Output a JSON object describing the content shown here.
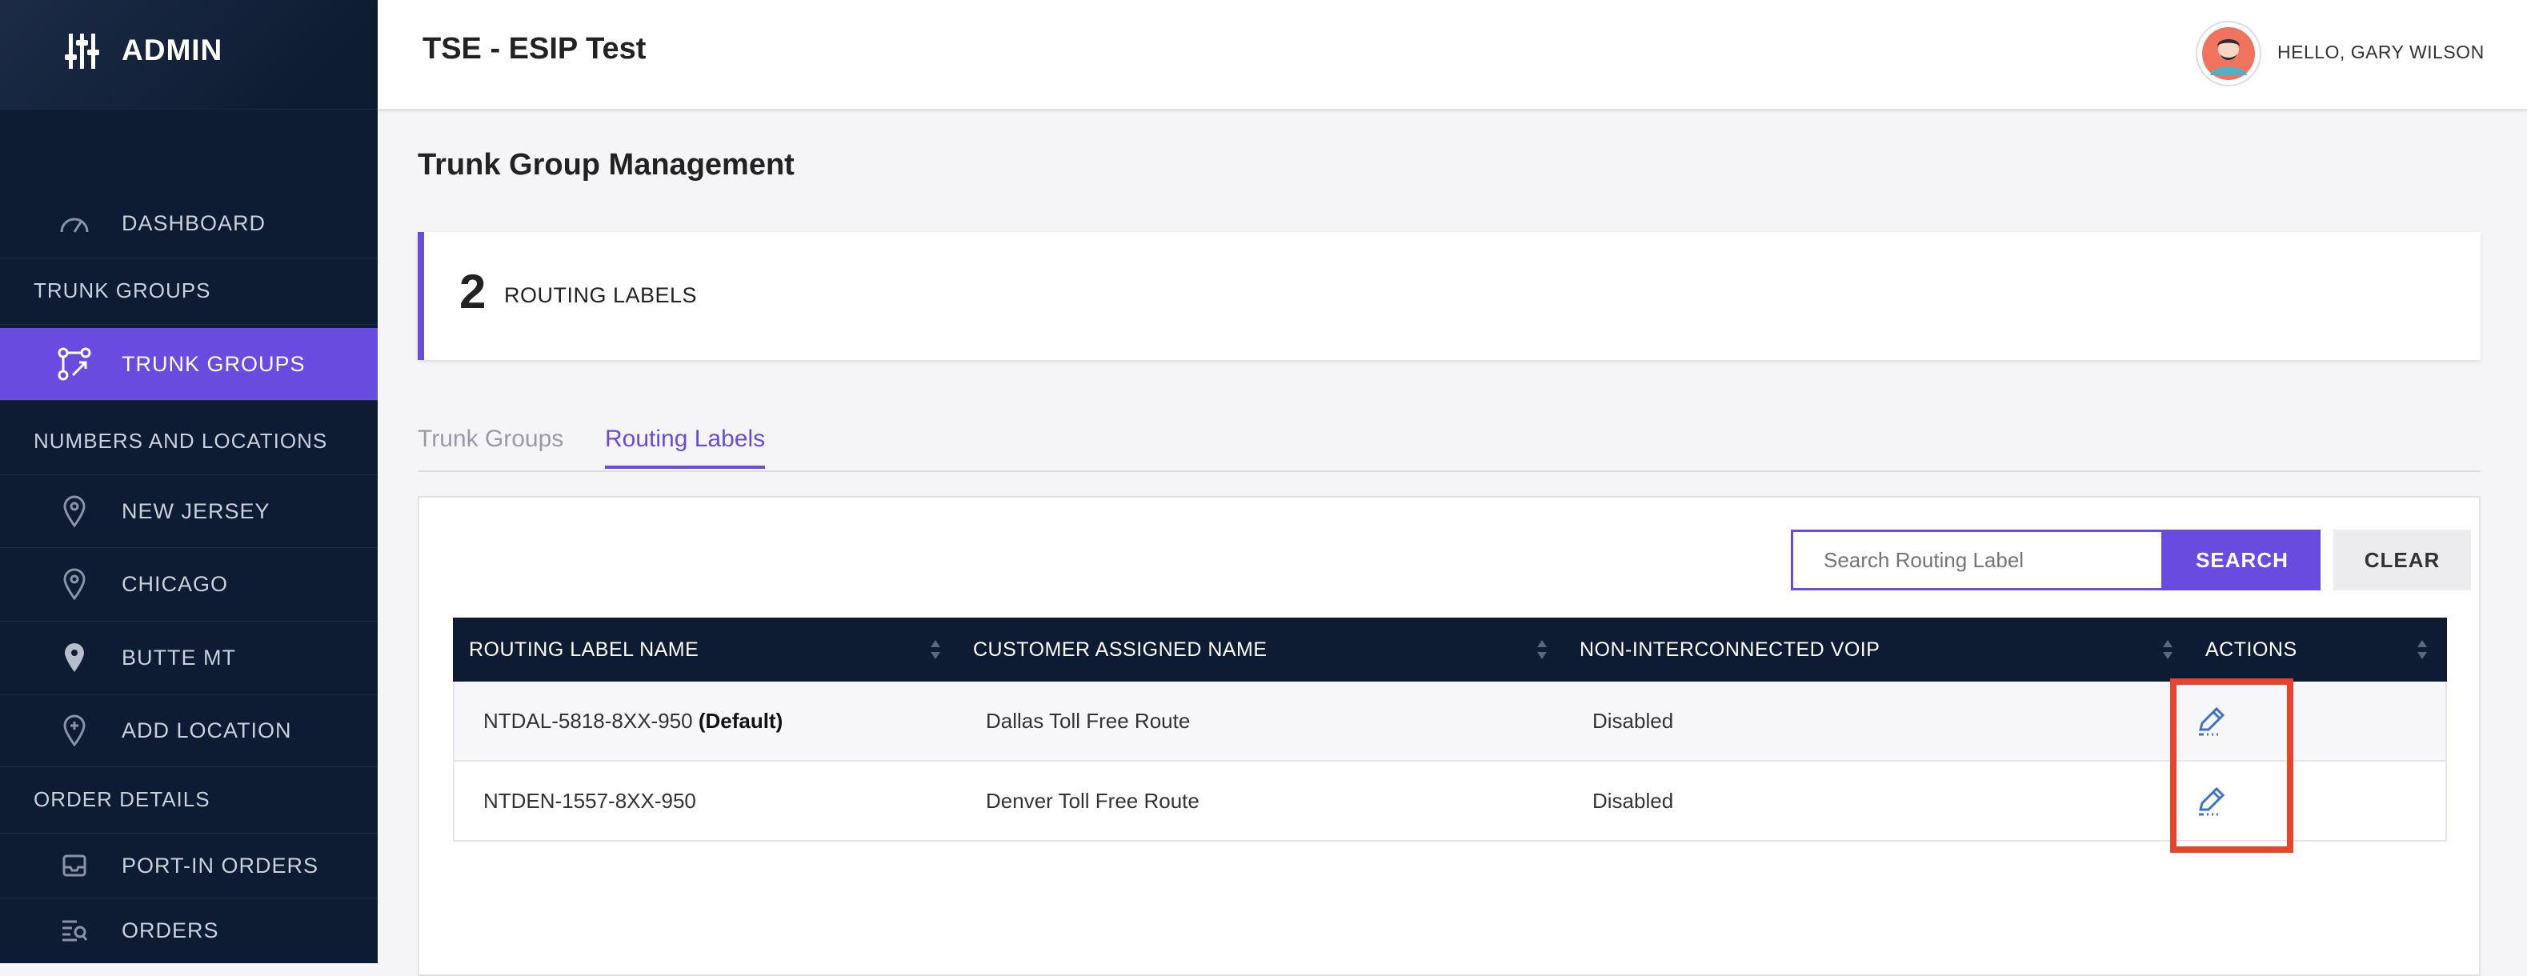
{
  "sidebar": {
    "brand": "ADMIN",
    "dashboard": "DASHBOARD",
    "section_trunk": "TRUNK GROUPS",
    "trunk_groups": "TRUNK GROUPS",
    "section_numbers": "NUMBERS AND LOCATIONS",
    "locations": [
      "NEW JERSEY",
      "CHICAGO",
      "BUTTE MT"
    ],
    "add_location": "ADD LOCATION",
    "section_orders": "ORDER DETAILS",
    "port_in_orders": "PORT-IN ORDERS",
    "orders": "ORDERS"
  },
  "header": {
    "title": "TSE - ESIP Test",
    "greeting": "HELLO, GARY WILSON"
  },
  "main": {
    "page_title": "Trunk Group Management",
    "count": "2",
    "count_label": "ROUTING LABELS",
    "tabs": [
      "Trunk Groups",
      "Routing Labels"
    ],
    "active_tab": "Routing Labels",
    "search_placeholder": "Search Routing Label",
    "search_label": "SEARCH",
    "clear_label": "CLEAR"
  },
  "table": {
    "columns": [
      "ROUTING LABEL NAME",
      "CUSTOMER ASSIGNED NAME",
      "NON-INTERCONNECTED VOIP",
      "ACTIONS"
    ],
    "rows": [
      {
        "name": "NTDAL-5818-8XX-950",
        "tag": "(Default)",
        "customer_name": "Dallas Toll Free Route",
        "voip": "Disabled"
      },
      {
        "name": "NTDEN-1557-8XX-950",
        "tag": "",
        "customer_name": "Denver Toll Free Route",
        "voip": "Disabled"
      }
    ]
  },
  "colors": {
    "accent": "#6a4be0",
    "sidebar_bg": "#0e1c33",
    "highlight": "#e8432c",
    "edit_icon": "#3d73c4"
  },
  "icons": {
    "brand": "sliders-icon",
    "dashboard": "speedometer-icon",
    "trunk_groups": "branch-icon",
    "location": "map-pin-icon",
    "add_location": "map-pin-plus-icon",
    "port_in": "inbox-icon",
    "orders": "list-search-icon",
    "edit": "pencil-icon"
  }
}
